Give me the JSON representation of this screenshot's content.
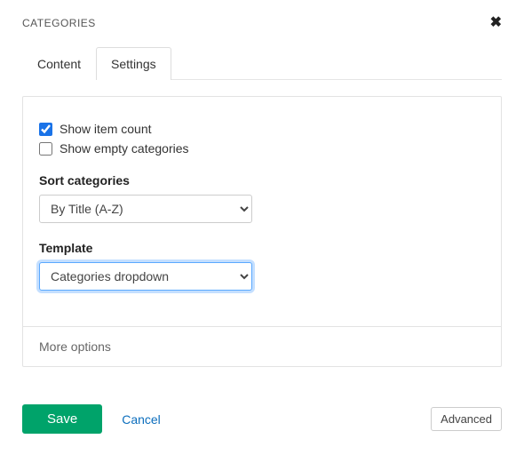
{
  "header": {
    "title": "CATEGORIES"
  },
  "tabs": {
    "content": "Content",
    "settings": "Settings"
  },
  "settings": {
    "show_item_count": {
      "label": "Show item count",
      "checked": true
    },
    "show_empty_categories": {
      "label": "Show empty categories",
      "checked": false
    },
    "sort_label": "Sort categories",
    "sort_value": "By Title (A-Z)",
    "template_label": "Template",
    "template_value": "Categories dropdown",
    "more_options": "More options"
  },
  "footer": {
    "save": "Save",
    "cancel": "Cancel",
    "advanced": "Advanced"
  }
}
